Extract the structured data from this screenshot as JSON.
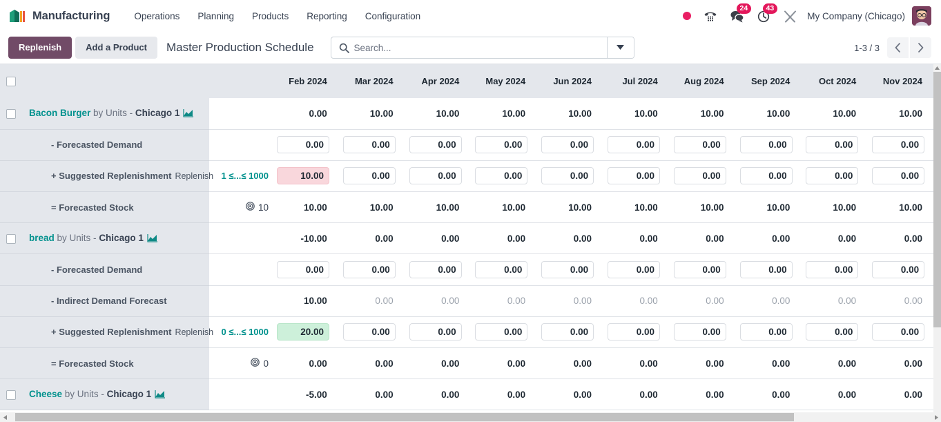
{
  "navbar": {
    "brand": "Manufacturing",
    "brand_logo_icon": "manufacturing-blocks-icon",
    "menu": [
      {
        "label": "Operations"
      },
      {
        "label": "Planning"
      },
      {
        "label": "Products"
      },
      {
        "label": "Reporting"
      },
      {
        "label": "Configuration"
      }
    ],
    "status_dot_icon": "recording-dot-icon",
    "phone_icon": "phone-dialpad-icon",
    "messages": {
      "icon": "chat-bubble-icon",
      "badge": "24"
    },
    "activities": {
      "icon": "clock-icon",
      "badge": "43"
    },
    "tools_icon": "tools-icon",
    "company": "My Company (Chicago)",
    "avatar_icon": "user-avatar"
  },
  "control_panel": {
    "replenish_label": "Replenish",
    "add_product_label": "Add a Product",
    "breadcrumb": "Master Production Schedule",
    "search_placeholder": "Search...",
    "search_value": "",
    "search_icon": "search-icon",
    "search_toggle_icon": "chevron-down-icon",
    "pager_count": "1-3 / 3",
    "pager_prev_icon": "chevron-left-icon",
    "pager_next_icon": "chevron-right-icon"
  },
  "table": {
    "columns": [
      "Feb 2024",
      "Mar 2024",
      "Apr 2024",
      "May 2024",
      "Jun 2024",
      "Jul 2024",
      "Aug 2024",
      "Sep 2024",
      "Oct 2024",
      "Nov 2024"
    ],
    "replenish_suffix": "Replenish",
    "rows": [
      {
        "type": "product",
        "name": "Bacon Burger",
        "by": "by Units -",
        "location": "Chicago 1",
        "chart_icon": "area-chart-icon",
        "checkbox_icon": "checkbox-unchecked",
        "range": "",
        "values": [
          "0.00",
          "10.00",
          "10.00",
          "10.00",
          "10.00",
          "10.00",
          "10.00",
          "10.00",
          "10.00",
          "10.00"
        ],
        "style": "plain"
      },
      {
        "type": "detail",
        "name": "- Forecasted Demand",
        "range": "",
        "values": [
          "0.00",
          "0.00",
          "0.00",
          "0.00",
          "0.00",
          "0.00",
          "0.00",
          "0.00",
          "0.00",
          "0.00"
        ],
        "style": "input"
      },
      {
        "type": "detail",
        "name": "+ Suggested Replenishment",
        "has_replenish": true,
        "range": "1 ≤...≤ 1000",
        "values": [
          "10.00",
          "0.00",
          "0.00",
          "0.00",
          "0.00",
          "0.00",
          "0.00",
          "0.00",
          "0.00",
          "0.00"
        ],
        "style": "input",
        "highlight": {
          "index": 0,
          "color": "pink"
        }
      },
      {
        "type": "detail",
        "name": "= Forecasted Stock",
        "range": "",
        "target_icon": "bullseye-icon",
        "target_value": "10",
        "values": [
          "10.00",
          "10.00",
          "10.00",
          "10.00",
          "10.00",
          "10.00",
          "10.00",
          "10.00",
          "10.00",
          "10.00"
        ],
        "style": "plain"
      },
      {
        "type": "product",
        "name": "bread",
        "by": "by Units -",
        "location": "Chicago 1",
        "chart_icon": "area-chart-icon",
        "checkbox_icon": "checkbox-unchecked",
        "range": "",
        "values": [
          "-10.00",
          "0.00",
          "0.00",
          "0.00",
          "0.00",
          "0.00",
          "0.00",
          "0.00",
          "0.00",
          "0.00"
        ],
        "style": "plain"
      },
      {
        "type": "detail",
        "name": "- Forecasted Demand",
        "range": "",
        "values": [
          "0.00",
          "0.00",
          "0.00",
          "0.00",
          "0.00",
          "0.00",
          "0.00",
          "0.00",
          "0.00",
          "0.00"
        ],
        "style": "input"
      },
      {
        "type": "detail",
        "name": "- Indirect Demand Forecast",
        "range": "",
        "values": [
          "10.00",
          "0.00",
          "0.00",
          "0.00",
          "0.00",
          "0.00",
          "0.00",
          "0.00",
          "0.00",
          "0.00"
        ],
        "style": "muted-after-first"
      },
      {
        "type": "detail",
        "name": "+ Suggested Replenishment",
        "has_replenish": true,
        "range": "0 ≤...≤ 1000",
        "values": [
          "20.00",
          "0.00",
          "0.00",
          "0.00",
          "0.00",
          "0.00",
          "0.00",
          "0.00",
          "0.00",
          "0.00"
        ],
        "style": "input",
        "highlight": {
          "index": 0,
          "color": "green"
        }
      },
      {
        "type": "detail",
        "name": "= Forecasted Stock",
        "range": "",
        "target_icon": "bullseye-icon",
        "target_value": "0",
        "values": [
          "0.00",
          "0.00",
          "0.00",
          "0.00",
          "0.00",
          "0.00",
          "0.00",
          "0.00",
          "0.00",
          "0.00"
        ],
        "style": "plain"
      },
      {
        "type": "product",
        "name": "Cheese",
        "by": "by Units -",
        "location": "Chicago 1",
        "chart_icon": "area-chart-icon",
        "checkbox_icon": "checkbox-unchecked",
        "range": "",
        "values": [
          "-5.00",
          "0.00",
          "0.00",
          "0.00",
          "0.00",
          "0.00",
          "0.00",
          "0.00",
          "0.00",
          "0.00"
        ],
        "style": "plain"
      }
    ]
  },
  "colors": {
    "brand_primary": "#714b67",
    "accent_teal": "#00918d",
    "badge_red": "#e3175b",
    "highlight_pink": "#f9d7dc",
    "highlight_green": "#cdf0da",
    "header_gray": "#e4e7ec"
  }
}
